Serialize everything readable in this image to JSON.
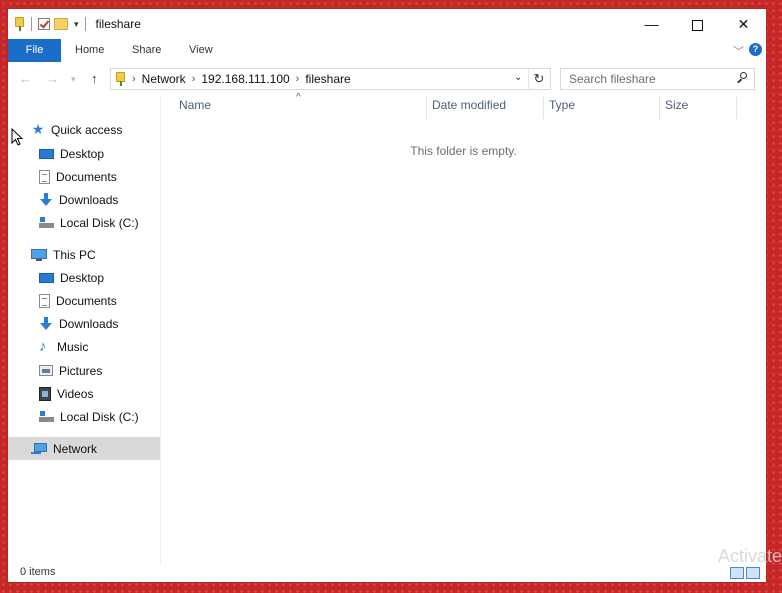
{
  "window": {
    "title": "fileshare",
    "controls": {
      "minimize": "—",
      "close": "✕"
    }
  },
  "ribbon": {
    "tabs": [
      "File",
      "Home",
      "Share",
      "View"
    ],
    "help": "?"
  },
  "address": {
    "crumbs": [
      "Network",
      "192.168.111.100",
      "fileshare"
    ]
  },
  "search": {
    "placeholder": "Search fileshare"
  },
  "nav": {
    "quick_access": "Quick access",
    "qa_items": [
      "Desktop",
      "Documents",
      "Downloads",
      "Local Disk (C:)"
    ],
    "this_pc": "This PC",
    "pc_items": [
      "Desktop",
      "Documents",
      "Downloads",
      "Music",
      "Pictures",
      "Videos",
      "Local Disk (C:)"
    ],
    "network": "Network"
  },
  "columns": {
    "name": "Name",
    "date": "Date modified",
    "type": "Type",
    "size": "Size"
  },
  "empty_message": "This folder is empty.",
  "status": {
    "items": "0 items"
  },
  "watermark": "Activate",
  "colors": {
    "accent": "#1a6ec7",
    "desktop_bg": "#c62828",
    "selected": "#d9d9d9"
  },
  "icons": [
    "folder-pin-icon",
    "check-icon",
    "folder-icon",
    "star-icon",
    "desktop-icon",
    "document-icon",
    "download-icon",
    "disk-icon",
    "pc-icon",
    "music-icon",
    "pictures-icon",
    "videos-icon",
    "network-icon",
    "search-icon"
  ]
}
